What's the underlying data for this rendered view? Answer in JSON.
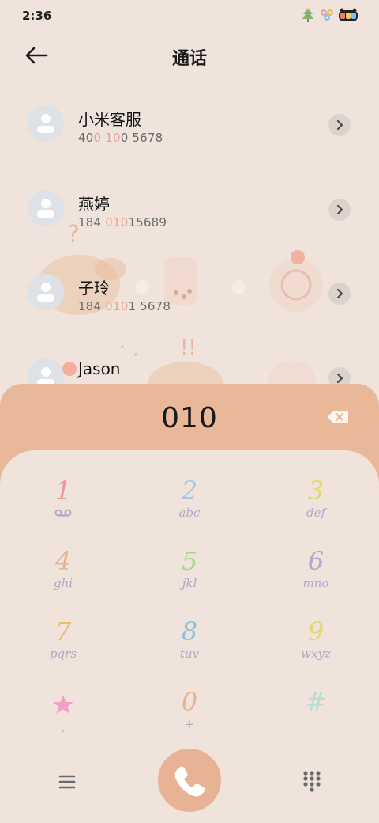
{
  "status_bar": {
    "time": "2:36",
    "icons": [
      "christmas-tree-icon",
      "flower-bunch-icon",
      "cat-battery-icon"
    ]
  },
  "header": {
    "title": "通话",
    "back_icon": "arrow-left-icon"
  },
  "contacts": [
    {
      "name": "小米客服",
      "number_parts": [
        "40",
        "0",
        " ",
        "10",
        "0 5678"
      ]
    },
    {
      "name": "燕婷",
      "number_parts": [
        "184 ",
        "010",
        "15689"
      ]
    },
    {
      "name": "子玲",
      "number_parts": [
        "184 ",
        "010",
        "1 5678"
      ]
    },
    {
      "name": "Jason",
      "number_parts": []
    }
  ],
  "dialer": {
    "input_value": "010",
    "backspace_icon": "backspace-icon",
    "keys": [
      {
        "digit": "1",
        "letters": "",
        "sub_icon": "voicemail-icon",
        "color": "#e89a9a"
      },
      {
        "digit": "2",
        "letters": "abc",
        "color": "#a9c8e8"
      },
      {
        "digit": "3",
        "letters": "def",
        "color": "#e2d86a"
      },
      {
        "digit": "4",
        "letters": "ghi",
        "color": "#e8b394"
      },
      {
        "digit": "5",
        "letters": "jkl",
        "color": "#a8d88a"
      },
      {
        "digit": "6",
        "letters": "mno",
        "color": "#b3a6c7"
      },
      {
        "digit": "7",
        "letters": "pqrs",
        "color": "#e8c06a"
      },
      {
        "digit": "8",
        "letters": "tuv",
        "color": "#8cc4e0"
      },
      {
        "digit": "9",
        "letters": "wxyz",
        "color": "#e2d86a"
      },
      {
        "digit": "*",
        "letters": ",",
        "sub_icon": "star-icon",
        "color": "#f0a0c0"
      },
      {
        "digit": "0",
        "letters": "+",
        "color": "#e8b394"
      },
      {
        "digit": "#",
        "letters": "",
        "color": "#b8dccf"
      }
    ]
  },
  "bottom_bar": {
    "menu_icon": "menu-icon",
    "call_icon": "phone-icon",
    "keypad_icon": "dialpad-icon"
  },
  "colors": {
    "background": "#efe3dc",
    "dial_header": "#e9b899",
    "call_button": "#e8b394",
    "highlight": "#e6a489"
  }
}
